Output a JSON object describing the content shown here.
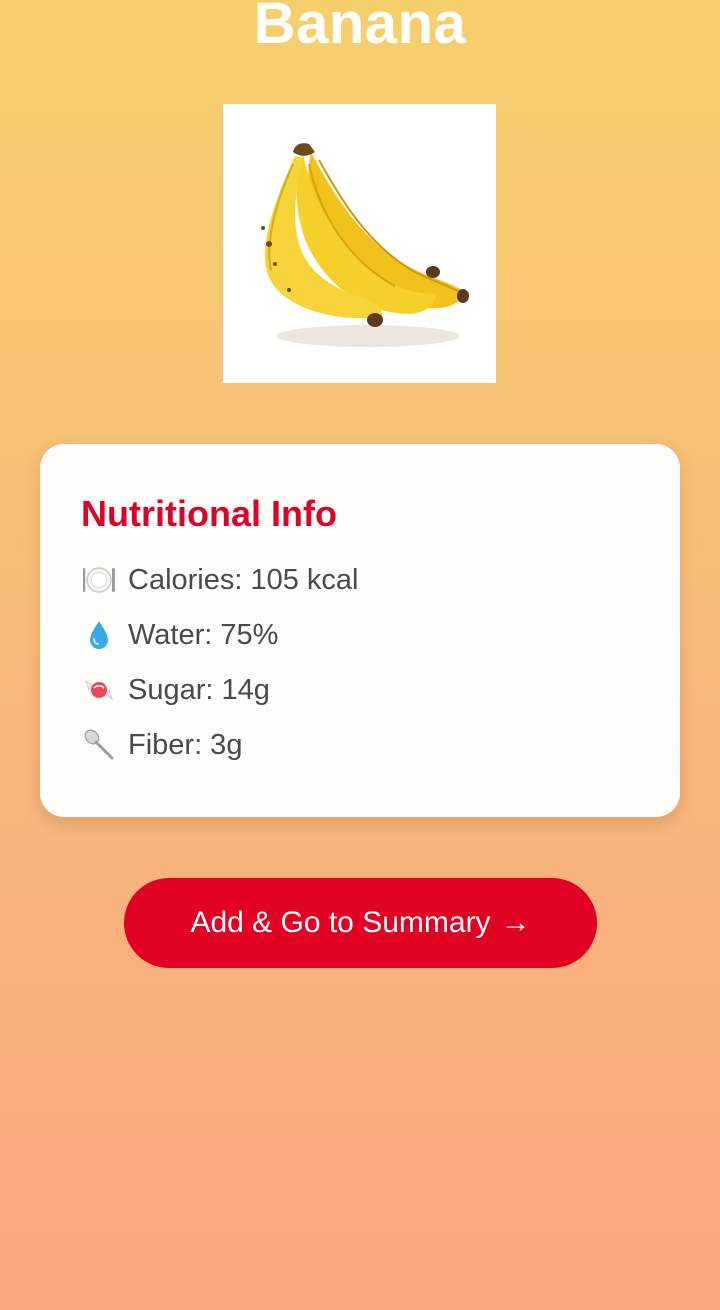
{
  "page": {
    "title": "Banana"
  },
  "image": {
    "subject": "banana-bunch"
  },
  "nutrition": {
    "title": "Nutritional Info",
    "items": [
      {
        "icon": "plate-cutlery-icon",
        "label": "Calories: 105 kcal"
      },
      {
        "icon": "water-drop-icon",
        "label": "Water: 75%"
      },
      {
        "icon": "candy-icon",
        "label": "Sugar: 14g"
      },
      {
        "icon": "spoon-icon",
        "label": "Fiber: 3g"
      }
    ]
  },
  "action": {
    "label": "Add & Go to Summary",
    "arrow": "→"
  },
  "colors": {
    "accent": "#e20023",
    "title_red": "#d9042b",
    "gradient_top": "#f6cf6d",
    "gradient_bottom": "#faa57f"
  }
}
